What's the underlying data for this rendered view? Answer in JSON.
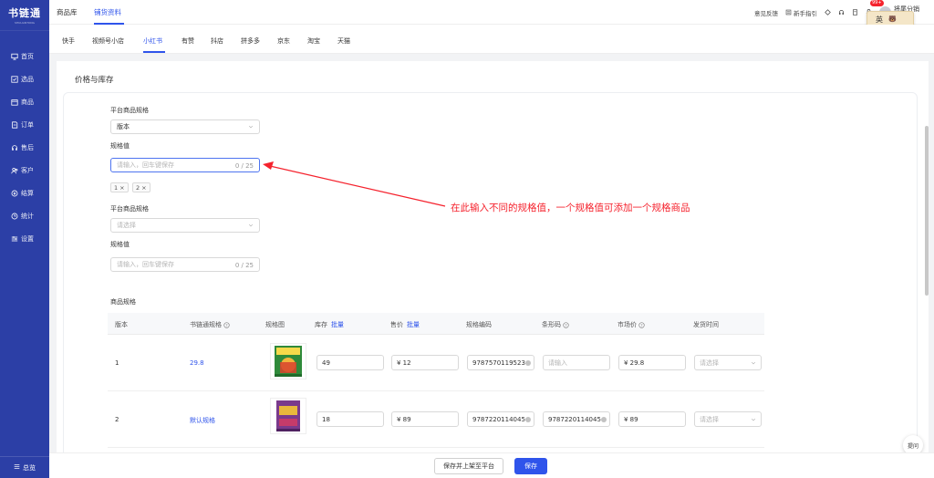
{
  "sidebar": {
    "logo": "书链通",
    "logo_sub": "SHULIANTONG",
    "items": [
      {
        "label": "首页",
        "icon": "monitor-icon"
      },
      {
        "label": "选品",
        "icon": "select-icon"
      },
      {
        "label": "商品",
        "icon": "box-icon"
      },
      {
        "label": "订单",
        "icon": "order-icon"
      },
      {
        "label": "售后",
        "icon": "headset-icon"
      },
      {
        "label": "客户",
        "icon": "users-icon"
      },
      {
        "label": "结算",
        "icon": "settle-icon"
      },
      {
        "label": "统计",
        "icon": "clock-icon"
      },
      {
        "label": "设置",
        "icon": "settings-icon"
      }
    ],
    "collapse_label": "总览"
  },
  "topbar": {
    "tabs": [
      "商品库",
      "铺货资料"
    ],
    "active_tab": "铺货资料",
    "feedback": "意见反馈",
    "guide": "新手指引",
    "badge": "99+",
    "user_name": "将尾分销",
    "user_sub": "会员",
    "lang": "英"
  },
  "platform_tabs": [
    "快手",
    "视频号小店",
    "小红书",
    "有赞",
    "抖店",
    "拼多多",
    "京东",
    "淘宝",
    "天猫"
  ],
  "active_platform": "小红书",
  "section": {
    "title": "价格与库存"
  },
  "spec_form": {
    "spec1_label": "平台商品规格",
    "spec1_value": "版本",
    "value1_label": "规格值",
    "value1_placeholder": "请输入，回车键保存",
    "value1_count": "0 / 25",
    "tags": [
      "1",
      "2"
    ],
    "spec2_label": "平台商品规格",
    "spec2_placeholder": "请选择",
    "value2_label": "规格值",
    "value2_placeholder": "请输入，回车键保存",
    "value2_count": "0 / 25"
  },
  "annotation": "在此输入不同的规格值，一个规格值可添加一个规格商品",
  "table": {
    "title": "商品规格",
    "headers": {
      "version": "版本",
      "sku_spec": "书链通规格",
      "image": "规格图",
      "stock": "库存",
      "price": "售价",
      "code": "规格编码",
      "barcode": "条形码",
      "market_price": "市场价",
      "ship_time": "发货时间",
      "batch": "批量"
    },
    "rows": [
      {
        "version": "1",
        "spec": "29.8",
        "stock": "49",
        "price": "¥ 12",
        "code": "9787570119523",
        "barcode_placeholder": "请输入",
        "market_price": "¥ 29.8",
        "ship_placeholder": "请选择"
      },
      {
        "version": "2",
        "spec": "默认规格",
        "stock": "18",
        "price": "¥ 89",
        "code": "9787220114045",
        "barcode": "9787220114045",
        "market_price": "¥ 89",
        "ship_placeholder": "请选择"
      }
    ]
  },
  "footer": {
    "save_publish": "保存并上架至平台",
    "save": "保存"
  },
  "float_tip": "提问",
  "colors": {
    "sidebar": "#2c3fa6",
    "primary": "#2f54eb",
    "annotation": "#f5222d"
  }
}
